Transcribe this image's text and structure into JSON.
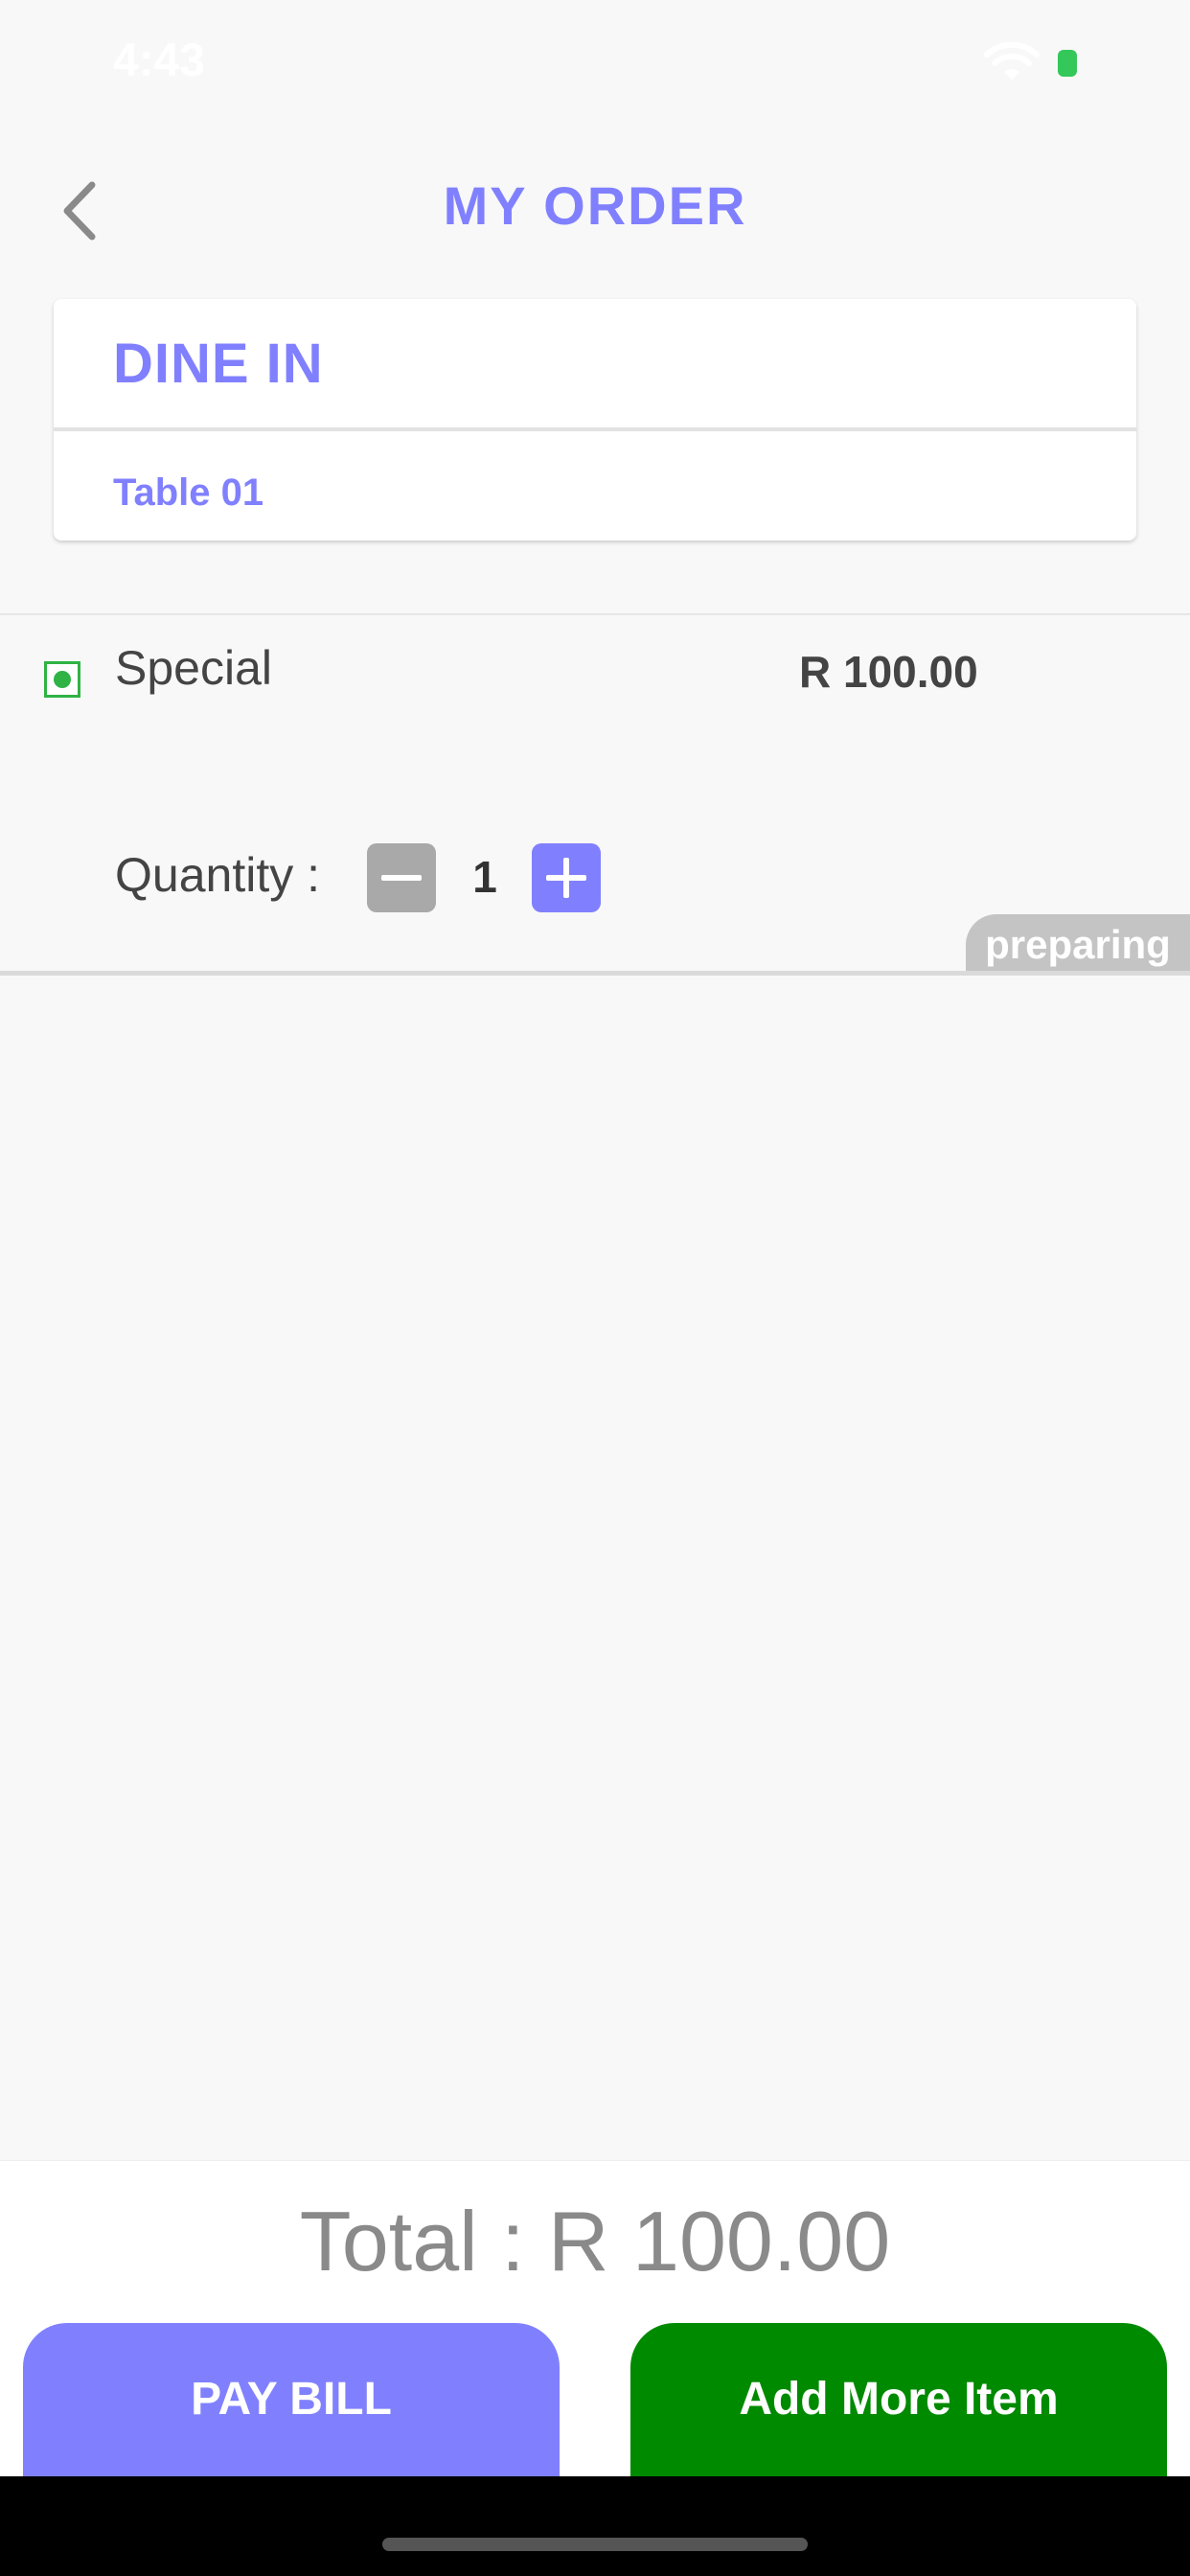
{
  "status_bar": {
    "time": "4:43",
    "battery_color": "#34c759"
  },
  "header": {
    "title": "MY ORDER",
    "back_icon": "chevron-left-icon"
  },
  "order_type": {
    "title": "DINE IN",
    "table": "Table 01"
  },
  "items": [
    {
      "name": "Special",
      "price": "R 100.00",
      "veg": true,
      "quantity_label": "Quantity :",
      "quantity": "1",
      "status": "preparing"
    }
  ],
  "footer": {
    "total": "Total : R 100.00",
    "pay_button": "PAY BILL",
    "add_button": "Add More Item"
  },
  "colors": {
    "accent": "#8080ff",
    "green": "#008a00",
    "veg": "#2fb344",
    "status_badge": "#c4c4c4"
  }
}
